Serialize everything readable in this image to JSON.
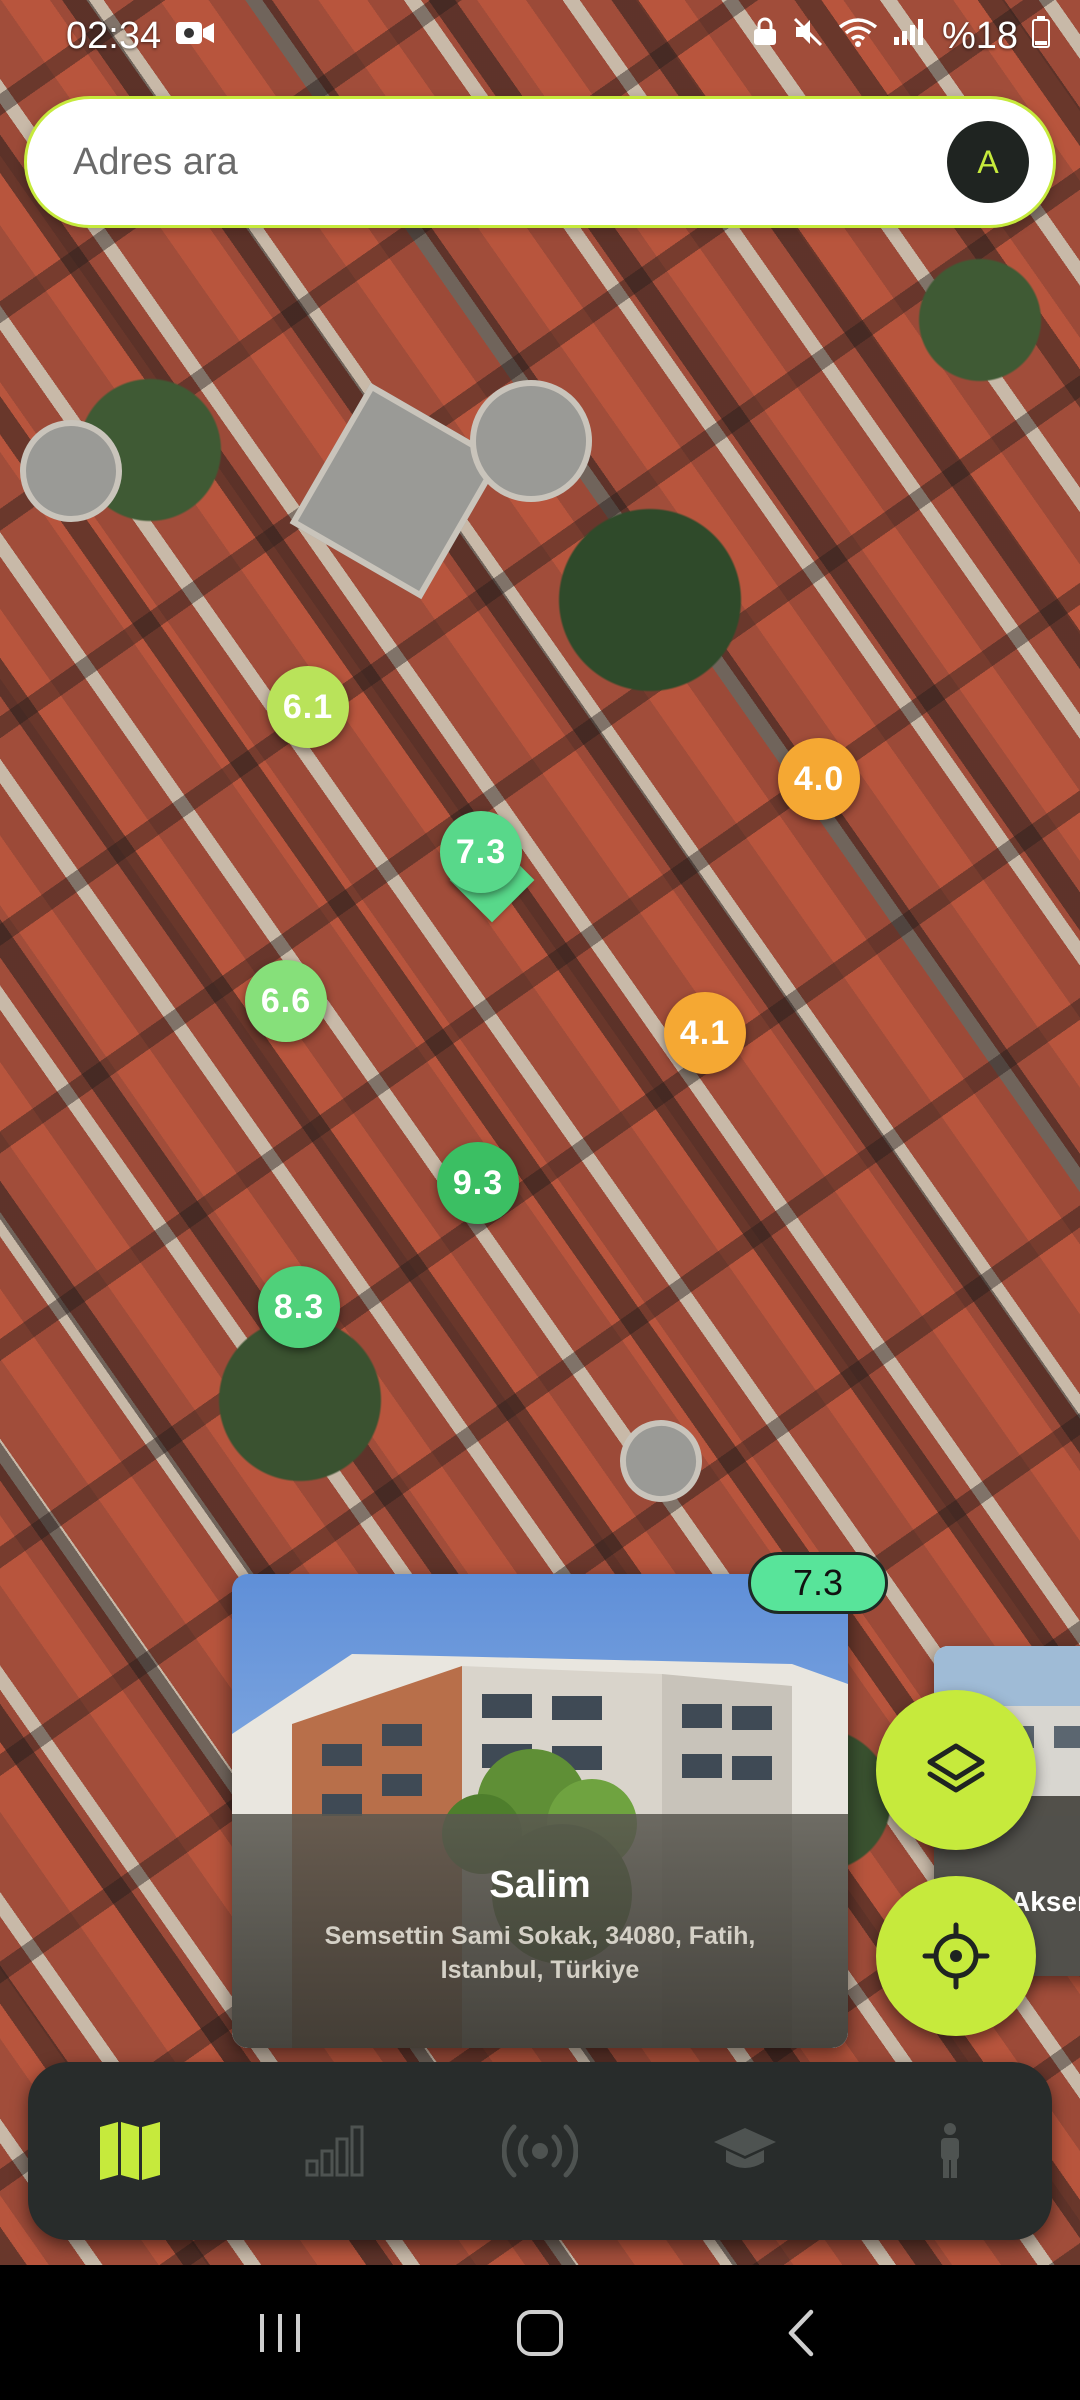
{
  "status_bar": {
    "time": "02:34",
    "battery": "%18",
    "icons": [
      "video-camera-icon",
      "lock-icon",
      "mute-icon",
      "wifi-icon",
      "signal-icon",
      "battery-icon"
    ]
  },
  "search": {
    "placeholder": "Adres ara",
    "avatar_initial": "A"
  },
  "markers": [
    {
      "score": "6.1",
      "color": "#b9e35a"
    },
    {
      "score": "4.0",
      "color": "#f5a833"
    },
    {
      "score": "7.3",
      "color": "#58d88a"
    },
    {
      "score": "6.6",
      "color": "#86e07a"
    },
    {
      "score": "4.1",
      "color": "#f5a833"
    },
    {
      "score": "9.3",
      "color": "#3bbf63"
    },
    {
      "score": "8.3",
      "color": "#4fd17a"
    }
  ],
  "card": {
    "score": "7.3",
    "title": "Salim",
    "address": "Semsettin Sami Sokak, 34080, Fatih, Istanbul, Türkiye"
  },
  "next_card": {
    "title": "Akser"
  },
  "fabs": {
    "layers": "layers-icon",
    "locate": "crosshair-icon"
  },
  "bottom_nav": {
    "items": [
      "map-icon",
      "bar-chart-icon",
      "broadcast-icon",
      "graduation-cap-icon",
      "person-icon"
    ],
    "active_index": 0
  },
  "colors": {
    "accent": "#c6ea3c",
    "nav_bg": "#282c2b",
    "inactive_icon": "#4e5351"
  }
}
